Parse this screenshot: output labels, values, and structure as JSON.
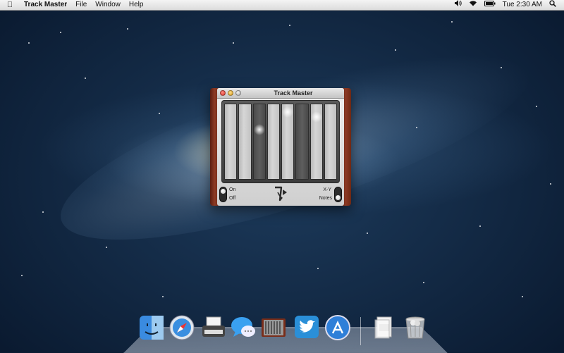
{
  "menubar": {
    "apple_icon": "apple-icon",
    "app_name": "Track Master",
    "menus": [
      "File",
      "Window",
      "Help"
    ],
    "status": {
      "volume_icon": "speaker-icon",
      "wifi_icon": "wifi-icon",
      "battery_icon": "battery-icon",
      "clock": "Tue 2:30 AM",
      "search_icon": "spotlight-icon"
    }
  },
  "window": {
    "title": "Track Master",
    "tracks": 8,
    "controls": {
      "on_label": "On",
      "off_label": "Off",
      "xy_label": "X-Y",
      "notes_label": "Notes"
    }
  },
  "dock": {
    "items": [
      {
        "name": "finder",
        "icon": "finder-icon"
      },
      {
        "name": "safari",
        "icon": "safari-icon"
      },
      {
        "name": "typewriter",
        "icon": "typewriter-icon"
      },
      {
        "name": "messages",
        "icon": "messages-icon"
      },
      {
        "name": "track-master",
        "icon": "track-master-icon"
      },
      {
        "name": "twitter",
        "icon": "twitter-icon"
      },
      {
        "name": "app-store",
        "icon": "app-store-icon"
      },
      {
        "name": "documents",
        "icon": "documents-icon"
      },
      {
        "name": "trash",
        "icon": "trash-icon"
      }
    ]
  },
  "colors": {
    "window_wood": "#7a2e1a",
    "menubar_bg": "#e8e8e8",
    "close_red": "#e0443a",
    "minimize_yellow": "#e8b23a"
  }
}
